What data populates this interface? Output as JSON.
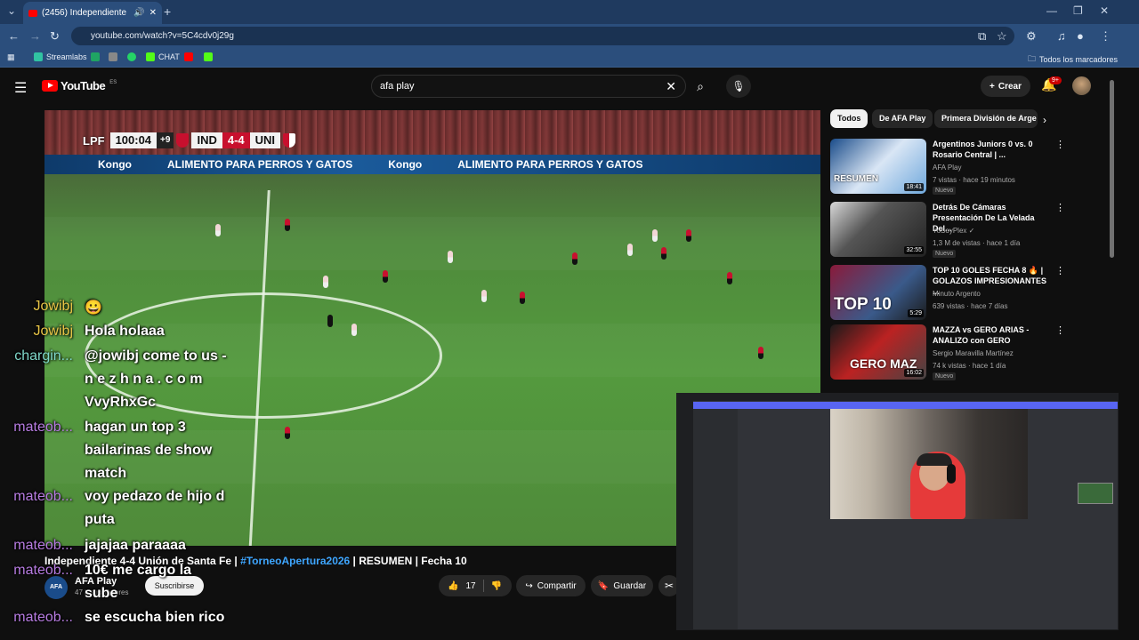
{
  "browser": {
    "tab_title": "(2456) Independiente 4-4 U...",
    "url": "youtube.com/watch?v=5C4cdv0j29g",
    "bookmarks": [
      "Streamlabs",
      "CHAT"
    ],
    "all_bookmarks": "Todos los marcadores"
  },
  "youtube": {
    "logo_text": "YouTube",
    "country": "ES",
    "search_value": "afa play",
    "create_label": "Crear",
    "notif_count": "9+"
  },
  "video": {
    "scorebug": {
      "league": "LPF",
      "time": "100:04",
      "added": "+9",
      "home": "IND",
      "score": "4-4",
      "away": "UNI"
    },
    "adboard": [
      "Kongo",
      "ALIMENTO PARA PERROS Y GATOS"
    ],
    "title_prefix": "Independiente 4-4 Unión de Santa Fe | ",
    "title_tag": "#TorneoApertura2026",
    "title_suffix": " | RESUMEN | Fecha 10",
    "channel_name": "AFA Play",
    "channel_subs": "47 k suscriptores",
    "subscribe_label": "Suscribirse",
    "likes": "17",
    "share_label": "Compartir",
    "save_label": "Guardar"
  },
  "chips": [
    "Todos",
    "De AFA Play",
    "Primera División de Arge"
  ],
  "recommendations": [
    {
      "title": "Argentinos Juniors 0 vs. 0 Rosario Central | ...",
      "channel": "AFA Play",
      "meta": "7 vistas · hace 19 minutos",
      "duration": "18:41",
      "badge": "Nuevo",
      "thumb_text": "RESUMEN"
    },
    {
      "title": "Detrás De Cámaras Presentación De La Velada Del...",
      "channel": "YoSoyPlex ✓",
      "meta": "1,3 M de vistas · hace 1 día",
      "duration": "32:55",
      "badge": "Nuevo",
      "thumb_text": ""
    },
    {
      "title": "TOP 10 GOLES FECHA 8 🔥 | GOLAZOS IMPRESIONANTES ...",
      "channel": "Minuto Argento",
      "meta": "639 vistas · hace 7 días",
      "duration": "5:29",
      "badge": "",
      "thumb_text": "TOP 10"
    },
    {
      "title": "MAZZA vs GERO ARIAS - ANALIZO con GERO",
      "channel": "Sergio Maravilla Martínez",
      "meta": "74 k vistas · hace 1 día",
      "duration": "16:02",
      "badge": "Nuevo",
      "thumb_text": "GERO MAZ"
    }
  ],
  "chat": [
    {
      "user": "Jowibj",
      "color": "#e8c547",
      "lines": [
        "😀"
      ]
    },
    {
      "user": "Jowibj",
      "color": "#e8c547",
      "lines": [
        "Hola holaaa"
      ]
    },
    {
      "user": "chargin...",
      "color": "#7fd7c9",
      "lines": [
        "@jowibj come to us -",
        "n e z h n a . c o m",
        "VvyRhxGc"
      ]
    },
    {
      "user": "mateob...",
      "color": "#b67be0",
      "lines": [
        "hagan un top 3",
        "bailarinas de show",
        "match"
      ]
    },
    {
      "user": "mateob...",
      "color": "#b67be0",
      "lines": [
        "voy pedazo de hijo d",
        "puta"
      ]
    },
    {
      "user": "mateob...",
      "color": "#b67be0",
      "lines": [
        "jajajaa paraaaa"
      ]
    },
    {
      "user": "mateob...",
      "color": "#b67be0",
      "lines": [
        "10€ me cargo la",
        "sube"
      ]
    },
    {
      "user": "mateob...",
      "color": "#b67be0",
      "lines": [
        "se escucha bien rico"
      ]
    }
  ]
}
